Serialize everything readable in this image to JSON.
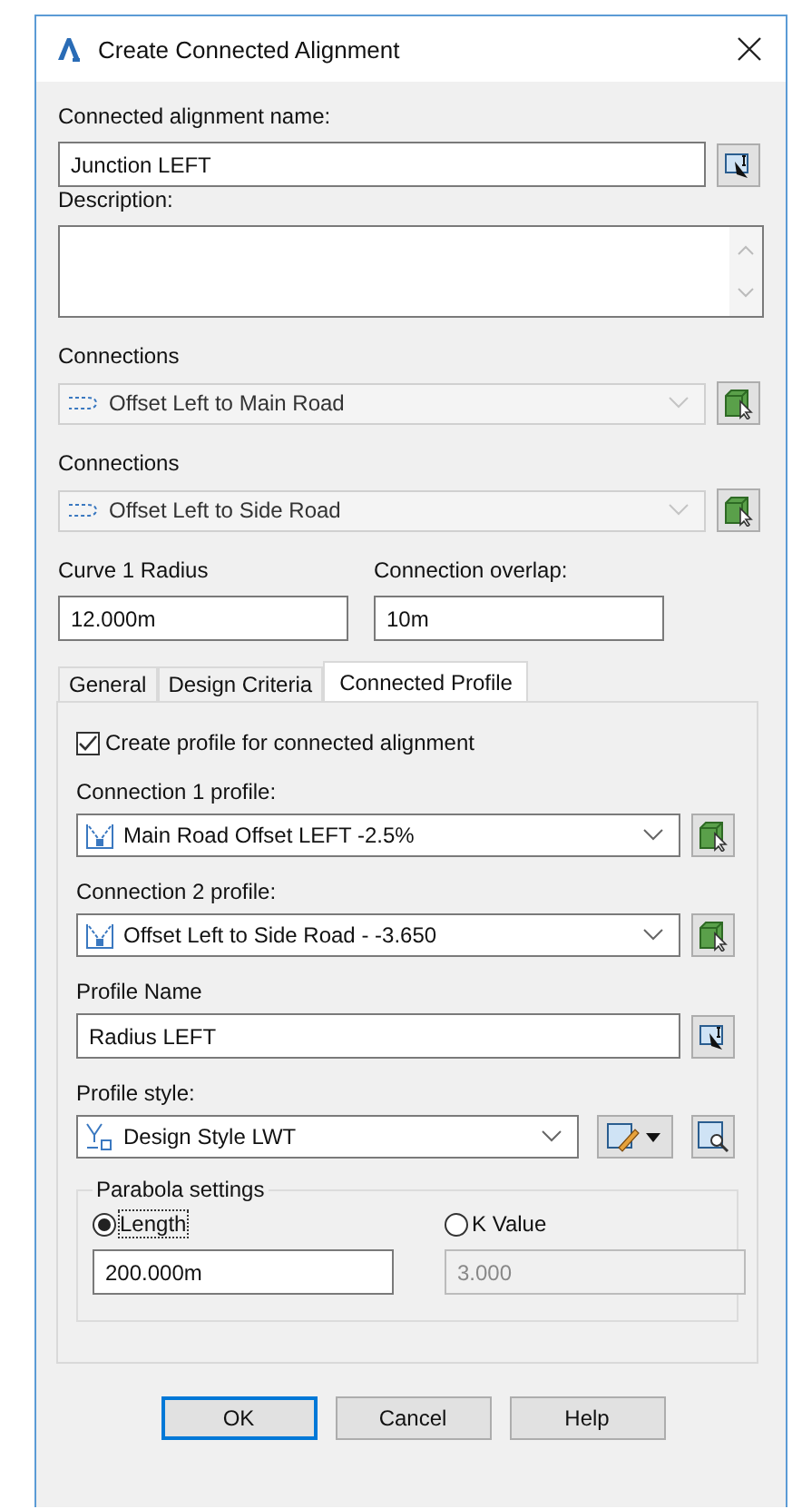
{
  "window": {
    "title": "Create Connected Alignment"
  },
  "name_field": {
    "label": "Connected alignment name:",
    "value": "Junction LEFT"
  },
  "description_field": {
    "label": "Description:"
  },
  "connections": [
    {
      "label": "Connections",
      "value": "Offset Left to Main Road",
      "disabled": true
    },
    {
      "label": "Connections",
      "value": "Offset Left to Side Road",
      "disabled": true
    }
  ],
  "curve_radius": {
    "label": "Curve 1 Radius",
    "value": "12.000m"
  },
  "connection_overlap": {
    "label": "Connection overlap:",
    "value": "10m"
  },
  "tabs": [
    {
      "label": "General",
      "selected": false
    },
    {
      "label": "Design Criteria",
      "selected": false
    },
    {
      "label": "Connected Profile",
      "selected": true
    }
  ],
  "create_profile": {
    "label": "Create profile for connected alignment",
    "checked": true
  },
  "profiles": [
    {
      "label": "Connection 1 profile:",
      "value": "Main Road Offset LEFT -2.5%"
    },
    {
      "label": "Connection 2 profile:",
      "value": "Offset Left to Side Road - -3.650"
    }
  ],
  "profile_name": {
    "label": "Profile Name",
    "value": "Radius LEFT"
  },
  "profile_style": {
    "label": "Profile style:",
    "value": "Design Style LWT"
  },
  "parabola": {
    "title": "Parabola settings",
    "options": [
      {
        "label": "Length",
        "selected": true,
        "value": "200.000m"
      },
      {
        "label": "K Value",
        "selected": false,
        "value": "3.000"
      }
    ]
  },
  "buttons": [
    {
      "label": "OK",
      "default": true
    },
    {
      "label": "Cancel",
      "default": false
    },
    {
      "label": "Help",
      "default": false
    }
  ]
}
